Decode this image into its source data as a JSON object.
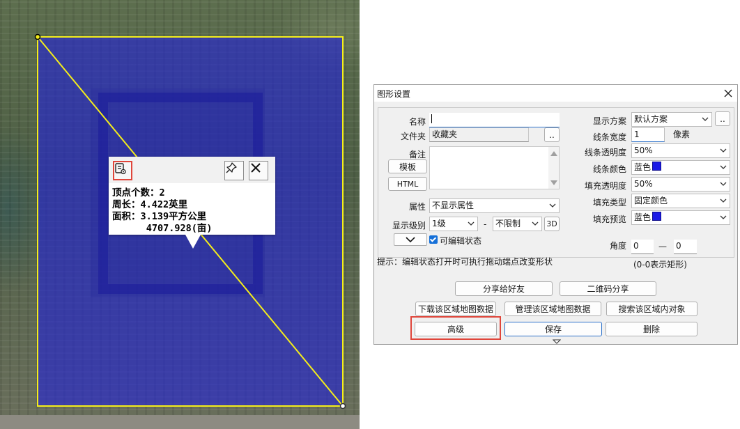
{
  "popup": {
    "info_lines": [
      "顶点个数：2",
      "周长：4.422英里",
      "面积：3.139平方公里",
      "      4707.928(亩)"
    ],
    "icons": [
      "document-settings-icon",
      "pin-icon",
      "close-icon"
    ]
  },
  "dialog": {
    "title": "图形设置",
    "fields": {
      "name_label": "名称",
      "name_value": "",
      "folder_label": "文件夹",
      "folder_value": "收藏夹",
      "folder_button": "..",
      "note_label": "备注",
      "template_button": "模板",
      "html_button": "HTML",
      "attr_label": "属性",
      "attr_value": "不显示属性",
      "level_label": "显示级别",
      "level_from": "1级",
      "level_sep": "-",
      "level_to": "不限制",
      "btn_3d": "3D",
      "editable_label": "可编辑状态",
      "editable_checked": true
    },
    "right": {
      "scheme_label": "显示方案",
      "scheme_value": "默认方案",
      "scheme_button": "..",
      "line_width_label": "线条宽度",
      "line_width_value": "1",
      "line_width_unit": "像素",
      "line_alpha_label": "线条透明度",
      "line_alpha_value": "50%",
      "line_color_label": "线条颜色",
      "line_color_value": "蓝色",
      "fill_alpha_label": "填充透明度",
      "fill_alpha_value": "50%",
      "fill_type_label": "填充类型",
      "fill_type_value": "固定颜色",
      "fill_preview_label": "填充预览",
      "fill_preview_value": "蓝色",
      "angle_label": "角度",
      "angle_from": "0",
      "angle_sep": "—",
      "angle_to": "0",
      "angle_hint": "(0-0表示矩形)"
    },
    "hint": "提示：编辑状态打开时可执行拖动端点改变形状",
    "buttons": {
      "share_friend": "分享给好友",
      "qr_share": "二维码分享",
      "download_map": "下载该区域地图数据",
      "manage_map": "管理该区域地图数据",
      "search_objects": "搜索该区域内对象",
      "advanced": "高级",
      "save": "保存",
      "delete": "删除"
    },
    "colors": {
      "swatch": "#1b19e6",
      "highlight": "#e0463b",
      "save_border": "#2a6fc9"
    }
  }
}
